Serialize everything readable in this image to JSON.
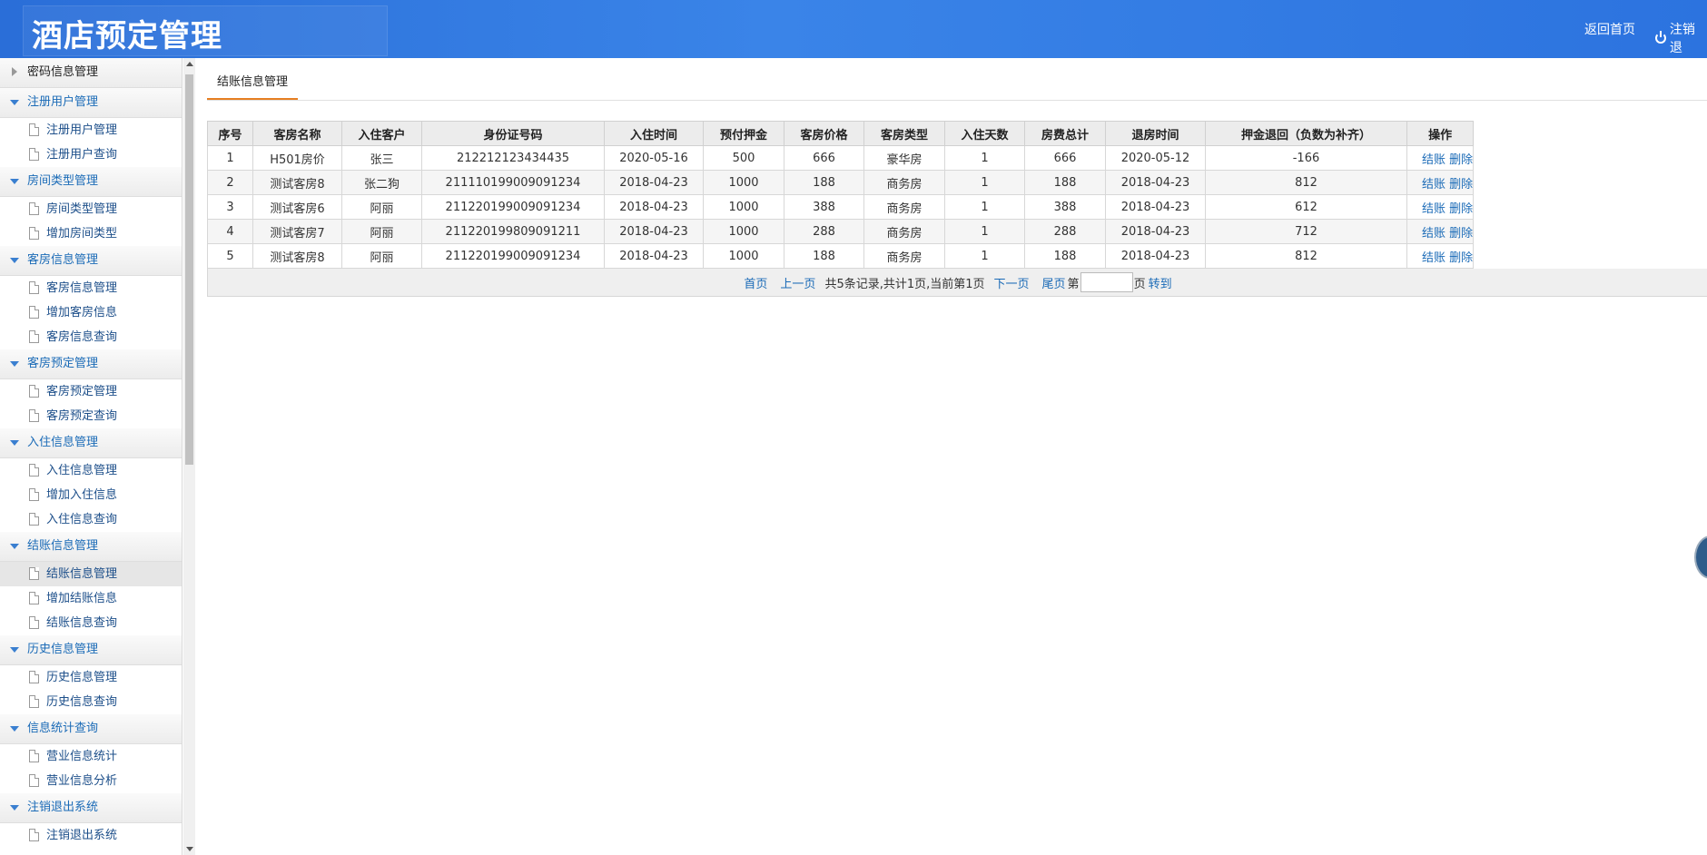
{
  "header": {
    "title": "酒店预定管理",
    "home_link": "返回首页",
    "logout_link": "注销退"
  },
  "sidebar": {
    "groups": [
      {
        "title": "密码信息管理",
        "collapsed": true,
        "items": []
      },
      {
        "title": "注册用户管理",
        "items": [
          "注册用户管理",
          "注册用户查询"
        ]
      },
      {
        "title": "房间类型管理",
        "items": [
          "房间类型管理",
          "增加房间类型"
        ]
      },
      {
        "title": "客房信息管理",
        "items": [
          "客房信息管理",
          "增加客房信息",
          "客房信息查询"
        ]
      },
      {
        "title": "客房预定管理",
        "items": [
          "客房预定管理",
          "客房预定查询"
        ]
      },
      {
        "title": "入住信息管理",
        "items": [
          "入住信息管理",
          "增加入住信息",
          "入住信息查询"
        ]
      },
      {
        "title": "结账信息管理",
        "items": [
          "结账信息管理",
          "增加结账信息",
          "结账信息查询"
        ]
      },
      {
        "title": "历史信息管理",
        "items": [
          "历史信息管理",
          "历史信息查询"
        ]
      },
      {
        "title": "信息统计查询",
        "items": [
          "营业信息统计",
          "营业信息分析"
        ]
      },
      {
        "title": "注销退出系统",
        "items": [
          "注销退出系统"
        ]
      }
    ],
    "active_item": "结账信息管理"
  },
  "tab": {
    "label": "结账信息管理"
  },
  "table": {
    "headers": [
      "序号",
      "客房名称",
      "入住客户",
      "身份证号码",
      "入住时间",
      "预付押金",
      "客房价格",
      "客房类型",
      "入住天数",
      "房费总计",
      "退房时间",
      "押金退回（负数为补齐）",
      "操作"
    ],
    "rows": [
      [
        "1",
        "H501房价",
        "张三",
        "212212123434435",
        "2020-05-16",
        "500",
        "666",
        "豪华房",
        "1",
        "666",
        "2020-05-12",
        "-166"
      ],
      [
        "2",
        "测试客房8",
        "张二狗",
        "211110199009091234",
        "2018-04-23",
        "1000",
        "188",
        "商务房",
        "1",
        "188",
        "2018-04-23",
        "812"
      ],
      [
        "3",
        "测试客房6",
        "阿丽",
        "211220199009091234",
        "2018-04-23",
        "1000",
        "388",
        "商务房",
        "1",
        "388",
        "2018-04-23",
        "612"
      ],
      [
        "4",
        "测试客房7",
        "阿丽",
        "211220199809091211",
        "2018-04-23",
        "1000",
        "288",
        "商务房",
        "1",
        "288",
        "2018-04-23",
        "712"
      ],
      [
        "5",
        "测试客房8",
        "阿丽",
        "211220199009091234",
        "2018-04-23",
        "1000",
        "188",
        "商务房",
        "1",
        "188",
        "2018-04-23",
        "812"
      ]
    ],
    "op_checkout": "结账",
    "op_delete": "删除"
  },
  "pager": {
    "first": "首页",
    "prev": "上一页",
    "summary": "共5条记录,共计1页,当前第1页",
    "next": "下一页",
    "last": "尾页",
    "page_prefix": "第",
    "page_suffix": "页",
    "goto": "转到",
    "page_input_value": ""
  },
  "colors": {
    "header_blue": "#2c73df",
    "link_blue": "#1b6bb7",
    "tab_underline": "#e67e22"
  }
}
